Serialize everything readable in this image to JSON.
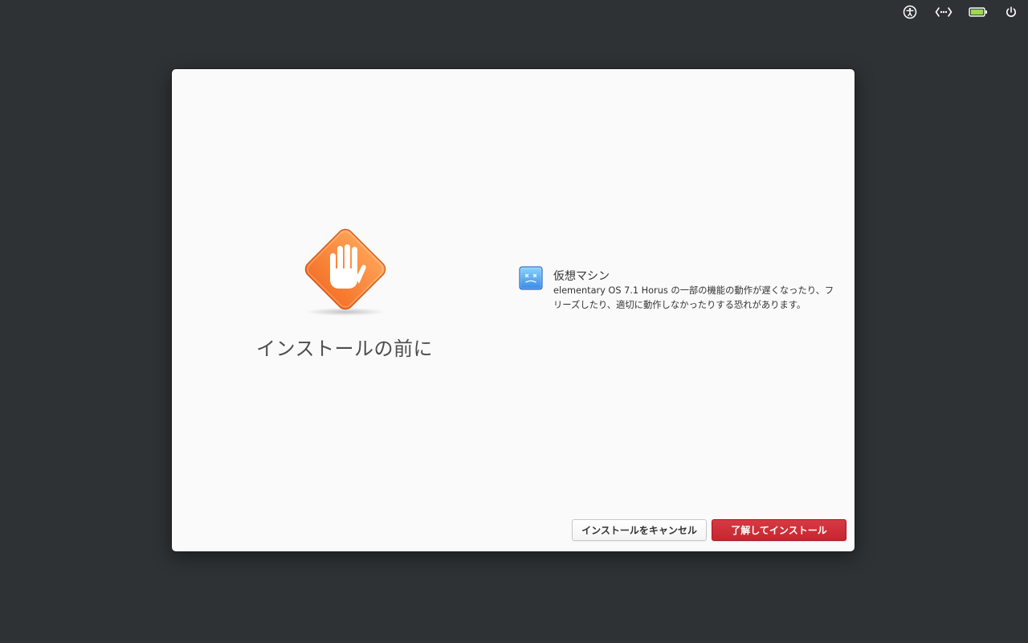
{
  "panel": {
    "indicators": [
      {
        "icon": "accessibility-icon"
      },
      {
        "icon": "network-wired-icon"
      },
      {
        "icon": "battery-icon",
        "color": "#9bdb4d"
      },
      {
        "icon": "power-icon"
      }
    ]
  },
  "dialog": {
    "title": "インストールの前に",
    "hero_icon": "stop-hand-icon",
    "issue": {
      "icon": "virtual-machine-icon",
      "title": "仮想マシン",
      "description": "elementary OS 7.1 Horus の一部の機能の動作が遅くなったり、フリーズしたり、適切に動作しなかったりする恐れがあります。"
    },
    "buttons": {
      "cancel_label": "インストールをキャンセル",
      "confirm_label": "了解してインストール"
    }
  },
  "colors": {
    "desktop": "#2e3235",
    "window": "#fafafa",
    "accent_destructive": "#c6262e",
    "warning_orange": "#f37329"
  }
}
